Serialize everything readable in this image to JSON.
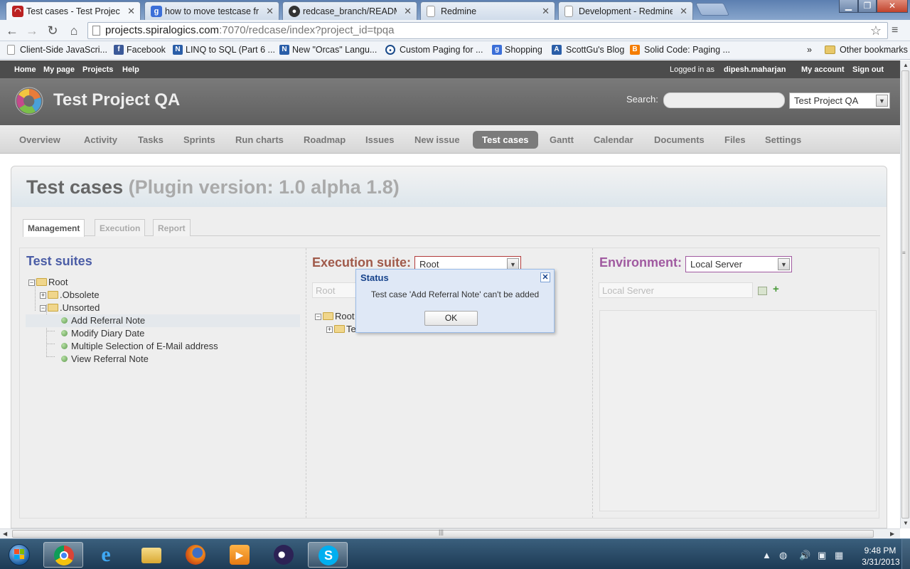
{
  "browser": {
    "tabs": [
      {
        "title": "Test cases - Test Project QA",
        "icon": "redmine-icon",
        "active": true
      },
      {
        "title": "how to move testcase from",
        "icon": "google-icon"
      },
      {
        "title": "redcase_branch/README.",
        "icon": "github-icon"
      },
      {
        "title": "Redmine",
        "icon": "page-icon"
      },
      {
        "title": "Development - Redmine",
        "icon": "page-icon"
      }
    ],
    "url_host": "projects.spiralogics.com",
    "url_rest": ":7070/redcase/index?project_id=tpqa",
    "bookmarks": [
      {
        "label": "Client-Side JavaScri...",
        "icon": "page-icon"
      },
      {
        "label": "Facebook",
        "icon": "facebook-icon"
      },
      {
        "label": "LINQ to SQL (Part 6 ...",
        "icon": "aspnet-icon"
      },
      {
        "label": "New \"Orcas\" Langu...",
        "icon": "aspnet-icon"
      },
      {
        "label": "Custom Paging for ...",
        "icon": "eye-icon"
      },
      {
        "label": "Shopping",
        "icon": "google-icon"
      },
      {
        "label": "ScottGu's Blog",
        "icon": "aspnet-icon"
      },
      {
        "label": "Solid Code: Paging ...",
        "icon": "blogger-icon"
      }
    ],
    "bookmarks_overflow": "»",
    "other_bookmarks": "Other bookmarks"
  },
  "top_menu": {
    "left": [
      "Home",
      "My page",
      "Projects",
      "Help"
    ],
    "logged_in_prefix": "Logged in as",
    "user": "dipesh.maharjan",
    "my_account": "My account",
    "sign_out": "Sign out"
  },
  "header": {
    "project_title": "Test Project QA",
    "search_label": "Search:",
    "search_value": "",
    "project_jump": "Test Project QA"
  },
  "main_menu": [
    {
      "label": "Overview"
    },
    {
      "label": "Activity"
    },
    {
      "label": "Tasks"
    },
    {
      "label": "Sprints"
    },
    {
      "label": "Run charts"
    },
    {
      "label": "Roadmap"
    },
    {
      "label": "Issues"
    },
    {
      "label": "New issue"
    },
    {
      "label": "Test cases",
      "selected": true
    },
    {
      "label": "Gantt"
    },
    {
      "label": "Calendar"
    },
    {
      "label": "Documents"
    },
    {
      "label": "Files"
    },
    {
      "label": "Settings"
    }
  ],
  "content": {
    "heading": "Test cases",
    "version": "(Plugin version: 1.0 alpha 1.8)",
    "subtabs": [
      {
        "label": "Management",
        "active": true
      },
      {
        "label": "Execution"
      },
      {
        "label": "Report"
      }
    ]
  },
  "test_suites": {
    "title": "Test suites",
    "root": "Root",
    "folders": [
      ".Obsolete",
      ".Unsorted"
    ],
    "cases": [
      "Add Referral Note",
      "Modify Diary Date",
      "Multiple Selection of E-Mail address",
      "View Referral Note"
    ],
    "selected_case": "Add Referral Note"
  },
  "execution_suite": {
    "title": "Execution suite:",
    "selected": "Root",
    "name_input_placeholder": "Root",
    "tree_root": "Root",
    "tree_child": "Te"
  },
  "environment": {
    "title": "Environment:",
    "selected": "Local Server",
    "name_input_placeholder": "Local Server",
    "add_symbol": "+"
  },
  "dialog": {
    "title": "Status",
    "message": "Test case 'Add Referral Note' can't be added",
    "ok": "OK",
    "close_symbol": "✕"
  },
  "taskbar": {
    "apps": [
      "chrome",
      "internet-explorer",
      "windows-explorer",
      "firefox",
      "media-player",
      "eclipse",
      "skype"
    ],
    "time": "9:48 PM",
    "date": "3/31/2013"
  },
  "colors": {
    "suite_title": "#4b5da6",
    "exec_title": "#a05a4a",
    "env_title": "#a05aa0",
    "dialog_title": "#15428b"
  }
}
